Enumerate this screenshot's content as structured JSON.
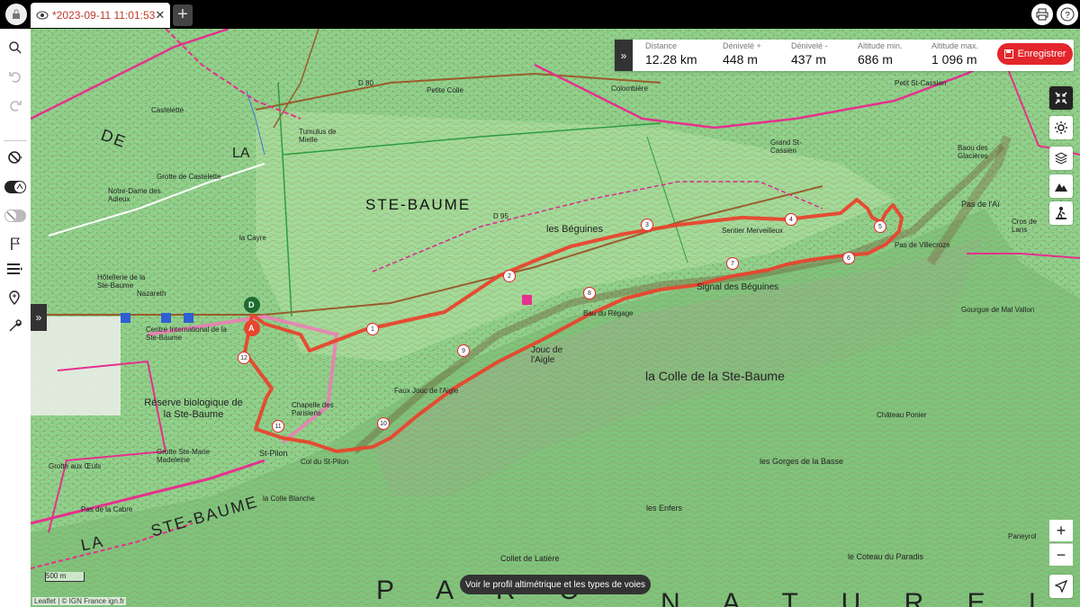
{
  "tab": {
    "title": "*2023-09-11 11:01:53",
    "close": "✕"
  },
  "newtab": "+",
  "stats": [
    {
      "label": "Distance",
      "value": "12.28 km"
    },
    {
      "label": "Dénivelé +",
      "value": "448 m"
    },
    {
      "label": "Dénivelé -",
      "value": "437 m"
    },
    {
      "label": "Altitude min.",
      "value": "686 m"
    },
    {
      "label": "Altitude max.",
      "value": "1 096 m"
    }
  ],
  "save_label": "Enregistrer",
  "profile_button": "Voir le profil altimétrique et les types de voies",
  "scale": "500 m",
  "attribution": "Leaflet | © IGN France ign.fr",
  "zoom": {
    "in": "+",
    "out": "−"
  },
  "map_labels": [
    "STE-BAUME",
    "les Béguines",
    "Signal des Béguines",
    "la Colle de la Ste-Baume",
    "Réserve biologique de la Ste-Baume",
    "Centre International de la Ste-Baume",
    "Hôtellerie de la Ste-Baume",
    "Nazareth",
    "Chapelle des Parisiens",
    "St-Pilon",
    "Col du St-Pilon",
    "Jouc de l'Aigle",
    "Bau du Régage",
    "les Gorges de la Basse",
    "les Enfers",
    "Collet de Latière",
    "le Coteau du Paradis",
    "Castelette",
    "Colombière",
    "Petite Colle",
    "Grand St-Cassien",
    "Petit St-Cassien",
    "Baou des Glacières",
    "Pas de l'Aï",
    "Pas de Villecroze",
    "Gourgue de Mal Vallon",
    "Château Ponier",
    "la Colle Blanche",
    "Grotte aux Œufs",
    "Grotte Ste-Marie Madeleine",
    "Sentier Merveilleux",
    "Tumulus de Mielle",
    "la Cayre",
    "D 80",
    "D 95",
    "LA",
    "STE-BAUME",
    "DE",
    "LA",
    "P A R C",
    "N A T U R E L",
    "Faux Jouc de l'Aigle",
    "Pas de la Cabre",
    "Grotte de Castelette",
    "Notre-Dame des Adieux",
    "Paneyrol",
    "Cros de Lans"
  ],
  "waypoints": [
    "1",
    "2",
    "3",
    "4",
    "5",
    "6",
    "7",
    "8",
    "9",
    "10",
    "11",
    "12"
  ],
  "markers": {
    "start": "D",
    "end": "A"
  },
  "colors": {
    "route": "#e8452d",
    "gr": "#e6308e",
    "accent": "#e3262b"
  }
}
